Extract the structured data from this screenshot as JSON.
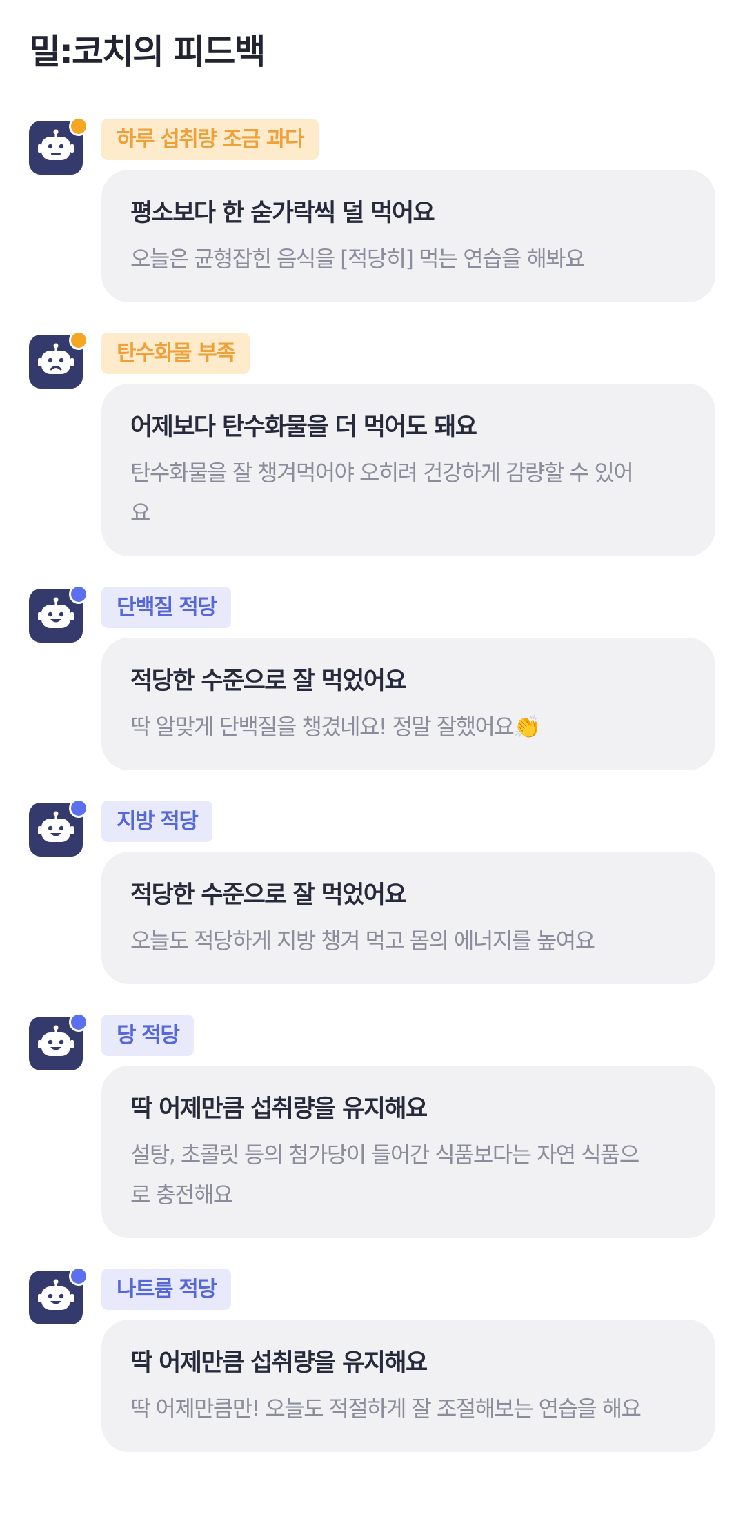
{
  "header": {
    "title": "밀:코치의 피드백"
  },
  "feedback": [
    {
      "tag": "하루 섭취량 조금 과다",
      "status": "warn",
      "face": "neutral",
      "title": "평소보다 한 숟가락씩 덜 먹어요",
      "body": "오늘은 균형잡힌 음식을 [적당히] 먹는 연습을 해봐요"
    },
    {
      "tag": "탄수화물 부족",
      "status": "warn",
      "face": "sad",
      "title": "어제보다 탄수화물을 더 먹어도 돼요",
      "body": "탄수화물을 잘 챙겨먹어야 오히려 건강하게 감량할 수 있어요"
    },
    {
      "tag": "단백질 적당",
      "status": "ok",
      "face": "happy",
      "title": "적당한 수준으로 잘 먹었어요",
      "body": "딱 알맞게 단백질을 챙겼네요! 정말 잘했어요👏"
    },
    {
      "tag": "지방 적당",
      "status": "ok",
      "face": "happy",
      "title": "적당한 수준으로 잘 먹었어요",
      "body": "오늘도 적당하게 지방 챙겨 먹고 몸의 에너지를 높여요"
    },
    {
      "tag": "당 적당",
      "status": "ok",
      "face": "happy",
      "title": "딱 어제만큼 섭취량을 유지해요",
      "body": "설탕, 초콜릿 등의 첨가당이 들어간 식품보다는 자연 식품으로 충전해요"
    },
    {
      "tag": "나트륨 적당",
      "status": "ok",
      "face": "happy",
      "title": "딱 어제만큼 섭취량을 유지해요",
      "body": "딱 어제만큼만! 오늘도 적절하게 잘 조절해보는 연습을 해요"
    }
  ],
  "colors": {
    "avatar_bg": "#343a6b",
    "warn_dot": "#f5a623",
    "ok_dot": "#5a70ee",
    "warn_tag_bg": "#feebcb",
    "warn_tag_text": "#eea13b",
    "ok_tag_bg": "#e8eafb",
    "ok_tag_text": "#5668d8",
    "card_bg": "#f1f1f4"
  }
}
